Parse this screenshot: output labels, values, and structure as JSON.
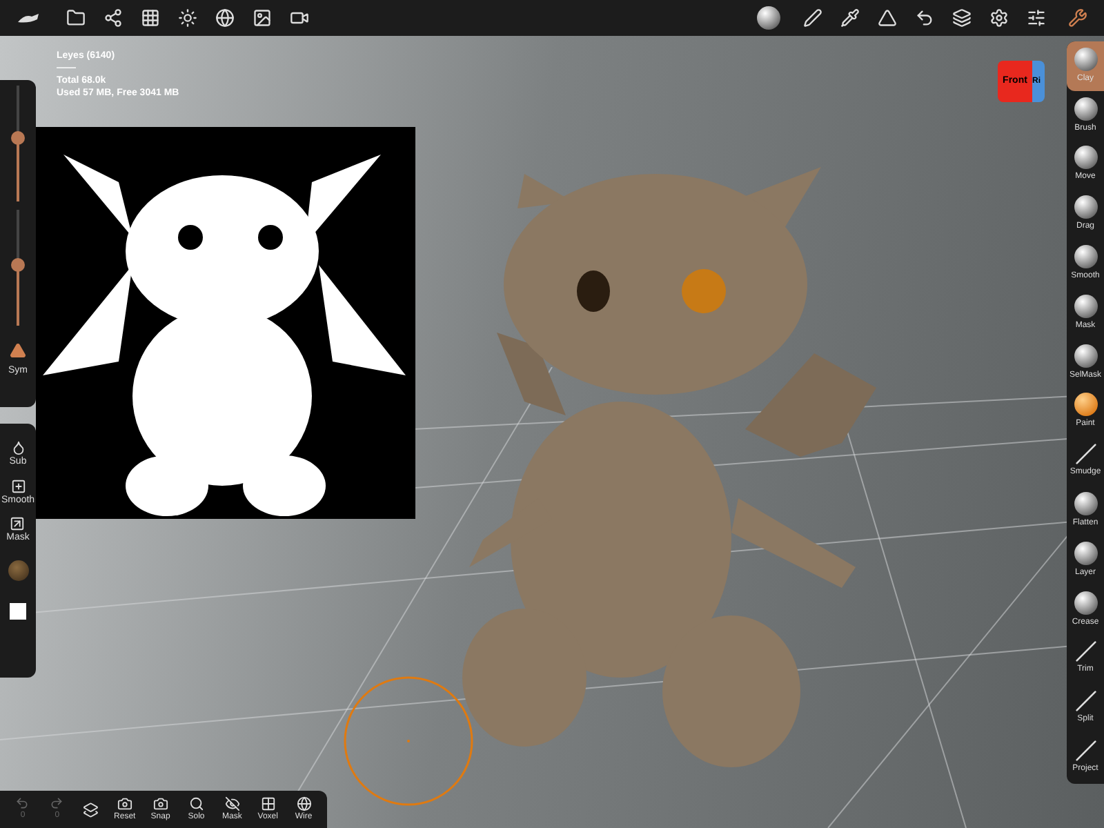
{
  "stats": [
    "Leyes (6140)",
    "——",
    "Total 68.0k",
    "Used 57 MB, Free 3041 MB"
  ],
  "gizmo": {
    "front": "Front",
    "side": "Ri"
  },
  "sliders": [
    {
      "level": 0.55
    },
    {
      "level": 0.52
    }
  ],
  "sym": {
    "label": "Sym",
    "on": true
  },
  "side_tools": [
    {
      "label": "Sub",
      "kind": "sub"
    },
    {
      "label": "Smooth",
      "kind": "smooth"
    },
    {
      "label": "Mask",
      "kind": "mask"
    }
  ],
  "tools": [
    {
      "label": "Clay",
      "kind": "sphere",
      "selected": true
    },
    {
      "label": "Brush",
      "kind": "sphere",
      "selected": false
    },
    {
      "label": "Move",
      "kind": "sphere",
      "selected": false
    },
    {
      "label": "Drag",
      "kind": "sphere",
      "selected": false
    },
    {
      "label": "Smooth",
      "kind": "sphere",
      "selected": false
    },
    {
      "label": "Mask",
      "kind": "sphere",
      "selected": false
    },
    {
      "label": "SelMask",
      "kind": "sphere",
      "selected": false
    },
    {
      "label": "Paint",
      "kind": "paint",
      "selected": false
    },
    {
      "label": "Smudge",
      "kind": "line",
      "selected": false
    },
    {
      "label": "Flatten",
      "kind": "sphere",
      "selected": false
    },
    {
      "label": "Layer",
      "kind": "sphere",
      "selected": false
    },
    {
      "label": "Crease",
      "kind": "sphere",
      "selected": false
    },
    {
      "label": "Trim",
      "kind": "line",
      "selected": false
    },
    {
      "label": "Split",
      "kind": "line",
      "selected": false
    },
    {
      "label": "Project",
      "kind": "line",
      "selected": false
    }
  ],
  "history": [
    {
      "label": "0",
      "kind": "undo",
      "disabled": true
    },
    {
      "label": "0",
      "kind": "redo",
      "disabled": true
    }
  ],
  "bottom_tools": [
    {
      "label": "Reset",
      "kind": "reset"
    },
    {
      "label": "Snap",
      "kind": "snap"
    },
    {
      "label": "Solo",
      "kind": "solo"
    },
    {
      "label": "Mask",
      "kind": "mask"
    },
    {
      "label": "Voxel",
      "kind": "voxel"
    },
    {
      "label": "Wire",
      "kind": "wire"
    }
  ]
}
